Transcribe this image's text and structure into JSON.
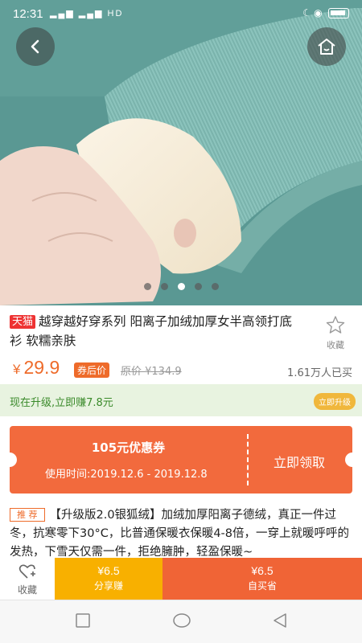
{
  "status_bar": {
    "time": "12:31",
    "network": "HD",
    "signal": "4G 4G"
  },
  "gallery": {
    "dot_count": 5,
    "active_index": 2
  },
  "product": {
    "platform_badge": "天猫",
    "title": "越穿越好穿系列 阳离子加绒加厚女半高领打底衫 软糯亲肤",
    "price_symbol": "¥",
    "price": "29.9",
    "after_coupon_tag": "券后价",
    "original_price": "原价 ¥134.9",
    "sold": "1.61万人已买",
    "fav_label": "收藏"
  },
  "upgrade": {
    "text": "现在升级,立即赚7.8元",
    "button": "立即升级"
  },
  "coupon": {
    "amount": "105元优惠券",
    "valid": "使用时间:2019.12.6 - 2019.12.8",
    "claim": "立即领取"
  },
  "recommend": {
    "tag": "推 荐",
    "text": "【升级版2.0银狐绒】加绒加厚阳离子德绒，真正一件过冬，抗寒零下30°C，比普通保暖衣保暖4-8倍，一穿上就暖呼呼的发热，下雪天仅需一件，拒绝臃肿，轻盈保暖~"
  },
  "action_bar": {
    "fav_label": "收藏",
    "share_amount": "¥6.5",
    "share_label": "分享赚",
    "buy_amount": "¥6.5",
    "buy_label": "自买省"
  },
  "colors": {
    "accent": "#f06436",
    "share": "#f8b000",
    "upgrade_bg": "#e8f3e0"
  }
}
